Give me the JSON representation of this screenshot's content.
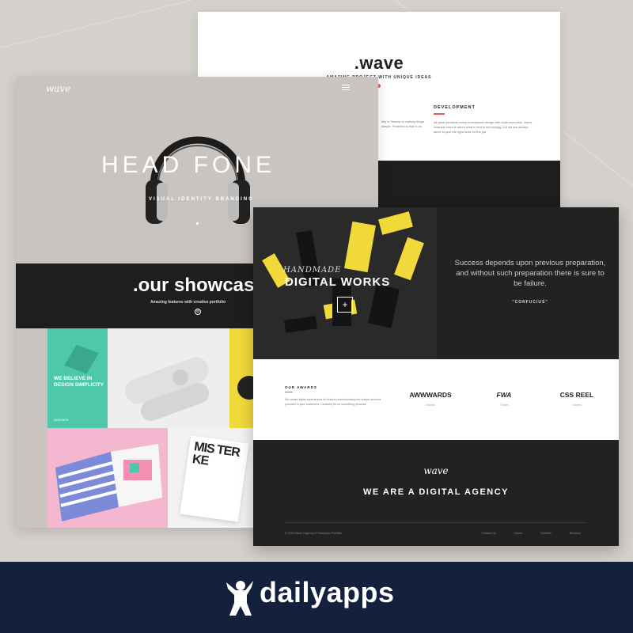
{
  "colors": {
    "background": "#d4d0cb",
    "dark": "#1e1e1e",
    "accent": "#e75a5a",
    "yellow": "#f1d93a",
    "mint": "#4ec8a8",
    "pink": "#f3b7cf",
    "banner": "#14213c"
  },
  "back_page": {
    "brand": ".wave",
    "tagline": "AMAZING PROJECT WITH UNIQUE IDEAS",
    "left_text": "lety is 'Beauty is making things simple. Pinterest is that is on",
    "development_title": "DEVELOPMENT",
    "development_text": "All great products every exceptional design with solid execution. We're insanely curious about what's next in technology, but we are always strive to pick the right tools for the job."
  },
  "left_page": {
    "logo": "wave",
    "menu_icon": "hamburger-icon",
    "hero_title": "HEAD FONE",
    "hero_subtitle": "VISUAL IDENTITY BRANDING",
    "showcase_title": ".our showcase",
    "showcase_subtitle": "Amazing features with creative portfolio",
    "showcase_icon": "settings-icon",
    "tile_text": "WE BELIEVE IN DESIGN SIMPLICITY",
    "tile_small": "DESIGNER",
    "poster_text": "MIS TER KE"
  },
  "right_page": {
    "image_caption": "HANDMADE",
    "image_title": "DIGITAL WORKS",
    "image_button": "+",
    "quote": "Success depends upon previous preparation, and without such preparation there is sure to be failure.",
    "quote_author": "\"CONFUCIUS\"",
    "awards_title": "OUR AWARDS",
    "awards_text": "We create digital experiences for brands communicating the unique services provided in your customers. Creativity for us something personal",
    "awards": [
      {
        "name": "AWWWARDS",
        "count": "5 times"
      },
      {
        "name": "FWA",
        "count": "7 times"
      },
      {
        "name": "CSS REEL",
        "count": "4 times"
      }
    ],
    "footer_logo": "wave",
    "footer_title": "WE ARE A DIGITAL AGENCY",
    "copyright": "© 2015 Wave | Agency & Freelancer Portfolio",
    "footer_links": [
      "Contact Us",
      "Career",
      "Dribbble",
      "Behance"
    ]
  },
  "banner": {
    "wordmark": "dailyapps",
    "mascot_icon": "dancing-figure-icon"
  }
}
